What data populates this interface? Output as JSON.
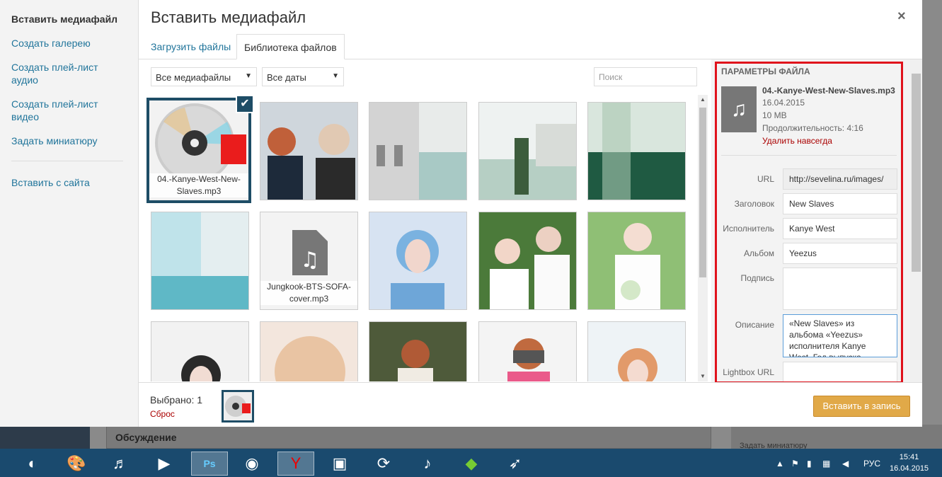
{
  "menu": {
    "insert_media": "Вставить медиафайл",
    "create_gallery": "Создать галерею",
    "create_audio_playlist": "Создать плей-лист аудио",
    "create_video_playlist": "Создать плей-лист видео",
    "set_thumbnail": "Задать миниатюру",
    "insert_from_url": "Вставить с сайта"
  },
  "modal": {
    "title": "Вставить медиафайл",
    "close": "×"
  },
  "tabs": {
    "upload": "Загрузить файлы",
    "library": "Библиотека файлов"
  },
  "filters": {
    "media_type": "Все медиафайлы",
    "dates": "Все даты",
    "search_placeholder": "Поиск"
  },
  "attachments": [
    {
      "filename": "04.-Kanye-West-New-Slaves.mp3"
    },
    {
      "filename": "Jungkook-BTS-SOFA-cover.mp3"
    }
  ],
  "details": {
    "heading": "ПАРАМЕТРЫ ФАЙЛА",
    "filename": "04.-Kanye-West-New-Slaves.mp3",
    "date": "16.04.2015",
    "size": "10 MB",
    "duration": "Продолжительность: 4:16",
    "delete": "Удалить навсегда",
    "labels": {
      "url": "URL",
      "title": "Заголовок",
      "artist": "Исполнитель",
      "album": "Альбом",
      "caption": "Подпись",
      "description": "Описание",
      "lightbox": "Lightbox URL"
    },
    "values": {
      "url": "http://sevelina.ru/images/",
      "title": "New Slaves",
      "artist": "Kanye West",
      "album": "Yeezus",
      "caption": "",
      "description": "«New Slaves» из альбома «Yeezus» исполнителя Kanye West. Год выпуска"
    }
  },
  "toolbar": {
    "selected": "Выбрано: 1",
    "reset": "Сброс",
    "insert": "Вставить в запись"
  },
  "background": {
    "discussion": "Обсуждение",
    "right_text": "Задать миниатюру"
  },
  "taskbar": {
    "lang": "РУС",
    "time": "15:41",
    "date": "16.04.2015"
  }
}
